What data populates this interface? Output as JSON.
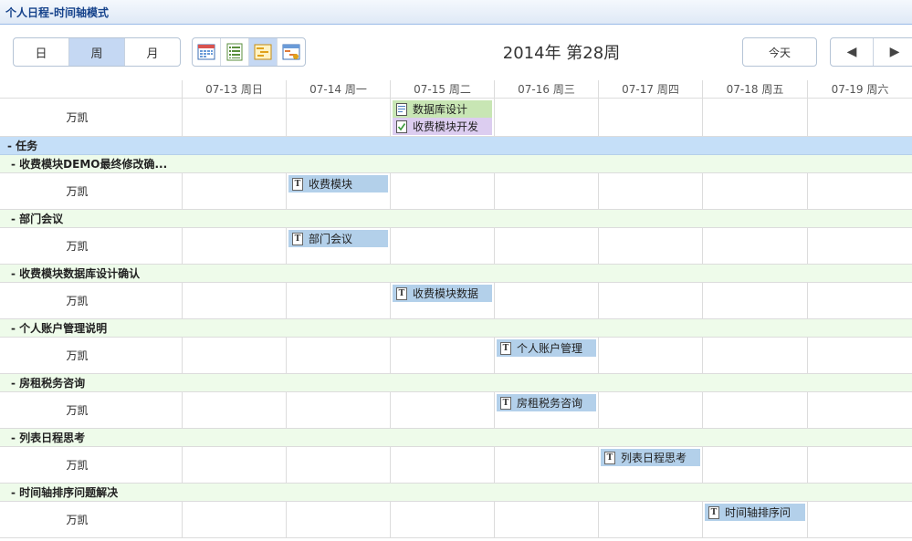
{
  "window_title": "个人日程-时间轴模式",
  "toolbar": {
    "seg": [
      {
        "label": "日"
      },
      {
        "label": "周"
      },
      {
        "label": "月"
      }
    ],
    "views": [
      "month-calendar-icon",
      "list-view-icon",
      "timeline-view-icon",
      "gantt-view-icon"
    ],
    "week_title": "2014年 第28周",
    "today": "今天",
    "prev": "◀",
    "next": "▶"
  },
  "days": [
    "07-13 周日",
    "07-14 周一",
    "07-15 周二",
    "07-16 周三",
    "07-17 周四",
    "07-18 周五",
    "07-19 周六"
  ],
  "top_row": {
    "name": "万凯",
    "events": [
      {
        "label": "数据库设计",
        "day": 2,
        "color": "#c8e6b4",
        "icon": "document-icon"
      },
      {
        "label": "收费模块开发",
        "day": 2,
        "color": "#dccdf0",
        "icon": "checklist-icon"
      }
    ]
  },
  "section": "- 任务",
  "tasks": [
    {
      "group": "- 收费模块DEMO最终修改确...",
      "name": "万凯",
      "day": 1,
      "event": "收费模块"
    },
    {
      "group": "- 部门会议",
      "name": "万凯",
      "day": 1,
      "event": "部门会议"
    },
    {
      "group": "- 收费模块数据库设计确认",
      "name": "万凯",
      "day": 2,
      "event": "收费模块数据"
    },
    {
      "group": "- 个人账户管理说明",
      "name": "万凯",
      "day": 3,
      "event": "个人账户管理"
    },
    {
      "group": "- 房租税务咨询",
      "name": "万凯",
      "day": 3,
      "event": "房租税务咨询"
    },
    {
      "group": "- 列表日程思考",
      "name": "万凯",
      "day": 4,
      "event": "列表日程思考"
    },
    {
      "group": "- 时间轴排序问题解决",
      "name": "万凯",
      "day": 5,
      "event": "时间轴排序问"
    }
  ],
  "colors": {
    "accent": "#c5d8f3",
    "task_event": "#b3d0ea",
    "section_bg": "#c5dff8",
    "group_bg": "#eefbea"
  }
}
